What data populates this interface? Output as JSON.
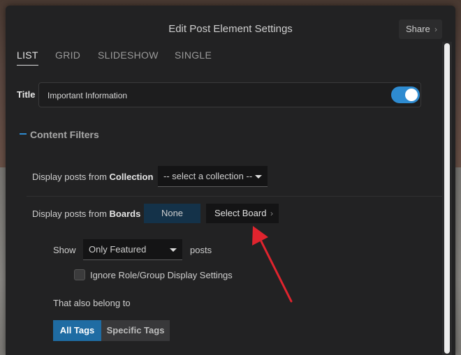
{
  "modal": {
    "title": "Edit Post Element Settings",
    "share_label": "Share",
    "share_chevron": "›"
  },
  "tabs": [
    {
      "label": "LIST",
      "active": true
    },
    {
      "label": "GRID",
      "active": false
    },
    {
      "label": "SLIDESHOW",
      "active": false
    },
    {
      "label": "SINGLE",
      "active": false
    }
  ],
  "title_row": {
    "label": "Title",
    "value": "Important Information",
    "toggle_on": true
  },
  "content_filters": {
    "header": "Content Filters",
    "collection": {
      "prefix": "Display posts from ",
      "strong": "Collection",
      "select_value": "-- select a collection --"
    },
    "boards": {
      "prefix": "Display posts from ",
      "strong": "Boards",
      "none_label": "None",
      "select_board_label": "Select Board",
      "select_board_chevron": "›"
    },
    "show": {
      "label": "Show",
      "select_value": "Only Featured",
      "suffix": "posts"
    },
    "ignore_checkbox": {
      "label": "Ignore Role/Group Display Settings",
      "checked": false
    },
    "belong": {
      "label": "That also belong to",
      "options": [
        "All Tags",
        "Specific Tags"
      ],
      "selected": "All Tags"
    }
  },
  "colors": {
    "accent": "#2e8bd0",
    "annotation_arrow": "#e0242e"
  }
}
